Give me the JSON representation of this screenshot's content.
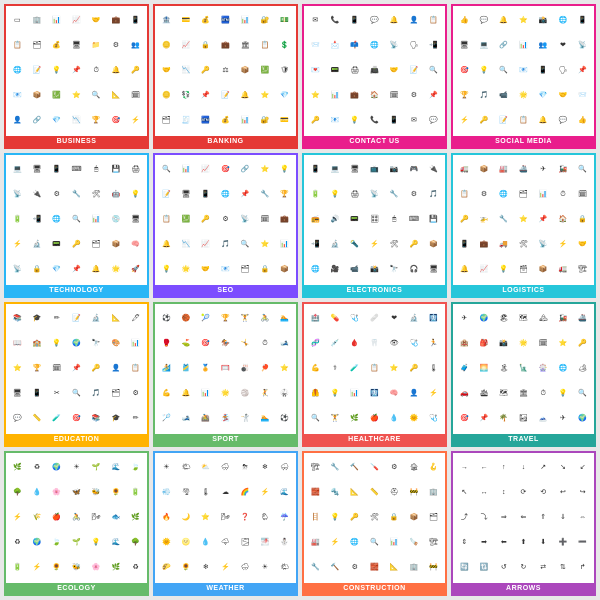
{
  "categories": [
    {
      "id": "business",
      "label": "BUSINESS",
      "labelClass": "lbl-business",
      "cardClass": "card-business",
      "icons": [
        "▭",
        "🏢",
        "📊",
        "📈",
        "🤝",
        "💼",
        "📱",
        "📋",
        "🗂",
        "💰",
        "🖥",
        "📁",
        "⚙",
        "👥",
        "🌐",
        "📝",
        "💡",
        "📌",
        "⏱",
        "🔔",
        "🔑",
        "📧",
        "📦",
        "💹",
        "⭐",
        "🔍",
        "📐",
        "🗓",
        "👤",
        "🔗",
        "💎",
        "📉",
        "🏆",
        "🎯",
        "⚡"
      ]
    },
    {
      "id": "banking",
      "label": "BANKING",
      "labelClass": "lbl-banking",
      "cardClass": "card-banking",
      "icons": [
        "🏦",
        "💳",
        "💰",
        "🏧",
        "📊",
        "🔐",
        "💵",
        "🪙",
        "📈",
        "🔒",
        "💼",
        "🏛",
        "📋",
        "💲",
        "🤝",
        "📉",
        "🔑",
        "⚖",
        "📦",
        "💹",
        "🛡",
        "🪙",
        "💱",
        "📌",
        "📝",
        "🔔",
        "⭐",
        "💎",
        "🗂",
        "🧾",
        "🏧",
        "💰",
        "📊",
        "🔐",
        "💳"
      ]
    },
    {
      "id": "contact",
      "label": "CONTACT US",
      "labelClass": "lbl-contact",
      "cardClass": "card-contact",
      "icons": [
        "✉",
        "📞",
        "📱",
        "💬",
        "🔔",
        "👤",
        "📋",
        "📨",
        "📩",
        "📫",
        "🌐",
        "📡",
        "🗣",
        "📲",
        "💌",
        "📟",
        "🖨",
        "📠",
        "🤝",
        "📝",
        "🔍",
        "⭐",
        "📊",
        "💼",
        "🏠",
        "🗓",
        "⚙",
        "📌",
        "🔑",
        "📧",
        "💡",
        "📞",
        "📱",
        "✉",
        "💬"
      ]
    },
    {
      "id": "social",
      "label": "SOCIAL MEDIA",
      "labelClass": "lbl-social",
      "cardClass": "card-social",
      "icons": [
        "👍",
        "💬",
        "🔔",
        "⭐",
        "📸",
        "🌐",
        "📱",
        "🖥",
        "💻",
        "🔗",
        "📊",
        "👥",
        "❤",
        "📡",
        "🎯",
        "💡",
        "🔍",
        "📧",
        "📱",
        "🗣",
        "📌",
        "🏆",
        "🎵",
        "📹",
        "🌟",
        "💎",
        "🤝",
        "📨",
        "⚡",
        "🔑",
        "📝",
        "📋",
        "🔔",
        "💬",
        "👍"
      ]
    },
    {
      "id": "technology",
      "label": "TECHNOLOGY",
      "labelClass": "lbl-technology",
      "cardClass": "card-technology",
      "icons": [
        "💻",
        "🖥",
        "📱",
        "⌨",
        "🖱",
        "💾",
        "🖨",
        "📡",
        "🔌",
        "⚙",
        "🔧",
        "🛠",
        "🤖",
        "💡",
        "🔋",
        "📲",
        "🌐",
        "🔍",
        "📊",
        "💿",
        "🖥",
        "⚡",
        "🔬",
        "📟",
        "🔑",
        "🗂",
        "📦",
        "🧠",
        "📡",
        "🔒",
        "💎",
        "📌",
        "🔔",
        "🌟",
        "🚀"
      ]
    },
    {
      "id": "seo",
      "label": "SEO",
      "labelClass": "lbl-seo",
      "cardClass": "card-seo",
      "icons": [
        "🔍",
        "📊",
        "📈",
        "🎯",
        "🔗",
        "⭐",
        "💡",
        "📝",
        "🖥",
        "📱",
        "🌐",
        "📌",
        "🔧",
        "🏆",
        "📋",
        "💹",
        "🔑",
        "⚙",
        "📡",
        "🗓",
        "💼",
        "🔔",
        "📉",
        "📈",
        "🎵",
        "🔍",
        "⭐",
        "📊",
        "💡",
        "🌟",
        "🤝",
        "📧",
        "🗂",
        "🔒",
        "📦"
      ]
    },
    {
      "id": "electronics",
      "label": "ELECTRONICS",
      "labelClass": "lbl-electronics",
      "cardClass": "card-electronics",
      "icons": [
        "📱",
        "💻",
        "🖥",
        "📺",
        "📷",
        "🎮",
        "🔌",
        "🔋",
        "💡",
        "🖨",
        "📡",
        "🔧",
        "⚙",
        "🎵",
        "📻",
        "🔊",
        "📟",
        "🎛",
        "🖱",
        "⌨",
        "💾",
        "📲",
        "🔬",
        "🔦",
        "⚡",
        "🛠",
        "🔑",
        "📦",
        "🌐",
        "🎥",
        "📹",
        "📸",
        "🔭",
        "🎧",
        "🖥"
      ]
    },
    {
      "id": "logistics",
      "label": "LOGISTICS",
      "labelClass": "lbl-logistics",
      "cardClass": "card-logistics",
      "icons": [
        "🚛",
        "📦",
        "🏭",
        "🚢",
        "✈",
        "🚂",
        "🔍",
        "📋",
        "⚙",
        "🌐",
        "🗂",
        "📊",
        "⏱",
        "🗓",
        "🔑",
        "🚁",
        "🔧",
        "⭐",
        "📌",
        "🏠",
        "🔒",
        "📱",
        "💼",
        "🚚",
        "🛠",
        "📡",
        "⚡",
        "🤝",
        "🔔",
        "📈",
        "💡",
        "🗃",
        "📦",
        "🚛",
        "🏗"
      ]
    },
    {
      "id": "education",
      "label": "EDUCATION",
      "labelClass": "lbl-education",
      "cardClass": "card-education",
      "icons": [
        "📚",
        "🎓",
        "✏",
        "📝",
        "🔬",
        "📐",
        "🖊",
        "📖",
        "🏫",
        "💡",
        "🌍",
        "🔭",
        "🎨",
        "📊",
        "⭐",
        "🏆",
        "🗓",
        "📌",
        "🔑",
        "👤",
        "📋",
        "🖥",
        "📱",
        "✂",
        "🔍",
        "🎵",
        "🗂",
        "⚙",
        "💬",
        "📏",
        "🧪",
        "🎯",
        "📚",
        "🎓",
        "✏"
      ]
    },
    {
      "id": "sport",
      "label": "SPORT",
      "labelClass": "lbl-sport",
      "cardClass": "card-sport",
      "icons": [
        "⚽",
        "🏀",
        "🎾",
        "🏆",
        "🏋",
        "🚴",
        "🏊",
        "🥊",
        "⛳",
        "🎯",
        "🏇",
        "🤸",
        "⏱",
        "🎿",
        "🏄",
        "🎽",
        "🏅",
        "🥅",
        "🎳",
        "🏓",
        "⭐",
        "💪",
        "🔔",
        "📊",
        "🌟",
        "🏐",
        "🤾",
        "🥋",
        "🏸",
        "🎿",
        "🚵",
        "🏂",
        "🤺",
        "🏊",
        "⚽"
      ]
    },
    {
      "id": "healthcare",
      "label": "HEALTHCARE",
      "labelClass": "lbl-healthcare",
      "cardClass": "card-healthcare",
      "icons": [
        "🏥",
        "💊",
        "🩺",
        "🩹",
        "❤",
        "🔬",
        "🩻",
        "🧬",
        "💉",
        "🩸",
        "🦷",
        "👁",
        "🩺",
        "🏃",
        "💪",
        "⚕",
        "🧪",
        "📋",
        "⭐",
        "🔑",
        "🌡",
        "🦺",
        "💡",
        "📊",
        "🩻",
        "🧠",
        "👤",
        "⚡",
        "🔍",
        "🏋",
        "🌿",
        "🍎",
        "💧",
        "🌞",
        "🩺"
      ]
    },
    {
      "id": "travel",
      "label": "TRAVEL",
      "labelClass": "lbl-travel",
      "cardClass": "card-travel",
      "icons": [
        "✈",
        "🌍",
        "🏖",
        "🗺",
        "🏔",
        "🚂",
        "🚢",
        "🏨",
        "🎒",
        "📸",
        "🌟",
        "🗓",
        "⭐",
        "🔑",
        "🧳",
        "🌅",
        "🏝",
        "🗽",
        "🎡",
        "🌐",
        "🏕",
        "🚗",
        "🛳",
        "🗺",
        "🏛",
        "⏱",
        "💡",
        "🔍",
        "🎯",
        "📌",
        "🌴",
        "🏜",
        "🗻",
        "✈",
        "🌍"
      ]
    },
    {
      "id": "ecology",
      "label": "ECOLOGY",
      "labelClass": "lbl-ecology",
      "cardClass": "card-ecology",
      "icons": [
        "🌿",
        "♻",
        "🌍",
        "☀",
        "🌱",
        "🌊",
        "🍃",
        "🌳",
        "💧",
        "🌸",
        "🦋",
        "🐝",
        "🌻",
        "🔋",
        "⚡",
        "🌾",
        "🍎",
        "🚴",
        "🌬",
        "🐟",
        "🌿",
        "♻",
        "🌍",
        "🍃",
        "🌱",
        "💡",
        "🌊",
        "🌳",
        "🔋",
        "⚡",
        "🌻",
        "🐝",
        "🌸",
        "🌿",
        "♻"
      ]
    },
    {
      "id": "weather",
      "label": "WEATHER",
      "labelClass": "lbl-weather",
      "cardClass": "card-weather",
      "icons": [
        "☀",
        "🌤",
        "⛅",
        "🌧",
        "⛈",
        "❄",
        "🌨",
        "💨",
        "🌪",
        "🌡",
        "☁",
        "🌈",
        "⚡",
        "🌊",
        "🔥",
        "🌙",
        "⭐",
        "🌬",
        "❓",
        "🌦",
        "☔",
        "🌞",
        "🌝",
        "💧",
        "🌩",
        "🌫",
        "🌁",
        "⛄",
        "🌮",
        "🌻",
        "❄",
        "⚡",
        "🌧",
        "☀",
        "🌤"
      ]
    },
    {
      "id": "construction",
      "label": "CONSTRUCTION",
      "labelClass": "lbl-construction",
      "cardClass": "card-construction",
      "icons": [
        "🏗",
        "🔧",
        "🔨",
        "🪛",
        "⚙",
        "🏚",
        "🪝",
        "🧱",
        "🔩",
        "📐",
        "📏",
        "⛑",
        "🚧",
        "🏢",
        "🪜",
        "💡",
        "🔑",
        "🛠",
        "🔒",
        "📦",
        "🗂",
        "🏭",
        "⚡",
        "🌐",
        "🔍",
        "📊",
        "🪚",
        "🏗",
        "🔧",
        "🔨",
        "⚙",
        "🧱",
        "📐",
        "🏢",
        "🚧"
      ]
    },
    {
      "id": "arrows",
      "label": "ARROWS",
      "labelClass": "lbl-arrows",
      "cardClass": "card-arrows",
      "icons": [
        "→",
        "←",
        "↑",
        "↓",
        "↗",
        "↘",
        "↙",
        "↖",
        "↔",
        "↕",
        "⟳",
        "⟲",
        "↩",
        "↪",
        "⤴",
        "⤵",
        "⇒",
        "⇐",
        "⇑",
        "⇓",
        "⇔",
        "⇕",
        "➡",
        "⬅",
        "⬆",
        "⬇",
        "➕",
        "➖",
        "🔄",
        "🔃",
        "↺",
        "↻",
        "⇄",
        "⇅",
        "↱"
      ]
    }
  ]
}
